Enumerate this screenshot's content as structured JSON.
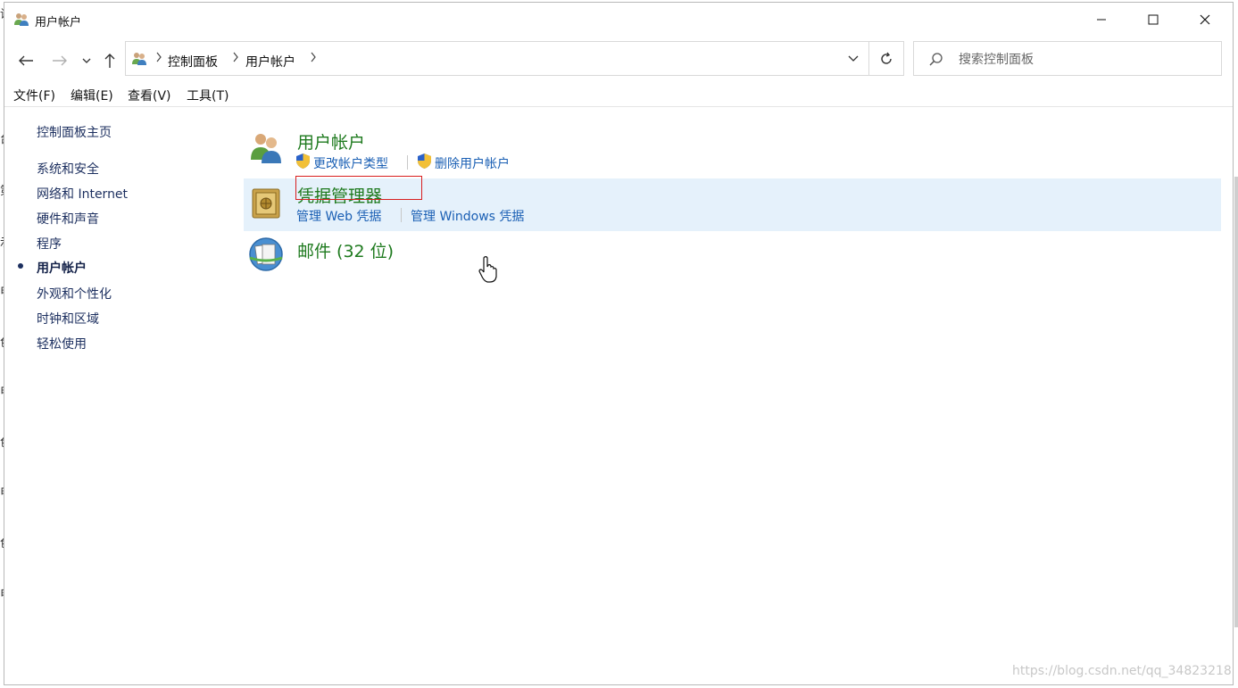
{
  "window": {
    "title": "用户帐户",
    "controls": {
      "minimize": "minimize-icon",
      "maximize": "maximize-icon",
      "close": "close-icon"
    }
  },
  "toolbar": {
    "breadcrumbs": [
      "控制面板",
      "用户帐户"
    ],
    "search_placeholder": "搜索控制面板"
  },
  "menu": [
    "文件(F)",
    "编辑(E)",
    "查看(V)",
    "工具(T)"
  ],
  "sidebar": {
    "home": "控制面板主页",
    "items": [
      {
        "label": "系统和安全",
        "current": false
      },
      {
        "label": "网络和 Internet",
        "current": false
      },
      {
        "label": "硬件和声音",
        "current": false
      },
      {
        "label": "程序",
        "current": false
      },
      {
        "label": "用户帐户",
        "current": true
      },
      {
        "label": "外观和个性化",
        "current": false
      },
      {
        "label": "时钟和区域",
        "current": false
      },
      {
        "label": "轻松使用",
        "current": false
      }
    ]
  },
  "categories": [
    {
      "title": "用户帐户",
      "icon": "users-icon",
      "links": [
        "更改帐户类型",
        "删除用户帐户"
      ]
    },
    {
      "title": "凭据管理器",
      "icon": "vault-icon",
      "links": [
        "管理 Web 凭据",
        "管理 Windows 凭据"
      ],
      "highlighted": true
    },
    {
      "title": "邮件 (32 位)",
      "icon": "mail-icon",
      "links": []
    }
  ],
  "left_edge_glyphs": [
    "设",
    "台",
    "第",
    "示",
    "电",
    "色",
    "电",
    "色",
    "电",
    "色",
    "电"
  ],
  "watermark": "https://blog.csdn.net/qq_34823218",
  "colors": {
    "category_title": "#1e7a1e",
    "task_link": "#1a5fb4",
    "highlight": "#e5f1fb",
    "annotation_box": "#d81e1e"
  }
}
